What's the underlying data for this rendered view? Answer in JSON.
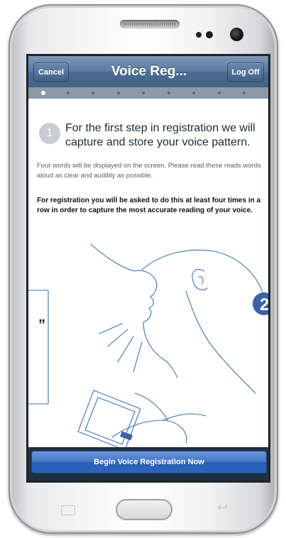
{
  "nav": {
    "cancel_label": "Cancel",
    "title": "Voice Reg...",
    "logoff_label": "Log Off"
  },
  "pager": {
    "total_pages": 9,
    "current_page": 1
  },
  "content": {
    "step_number": "1",
    "step_text": "For the first step in registration we will capture and store your voice pattern.",
    "description": "Four words will be displayed on the screen. Please read these reads words aloud as clear and audibly as possible.",
    "bold_note": "For registration you will be asked to do this at least four times in a row in order to capture the most accurate reading of your voice.",
    "illustration_badge": "2",
    "illustration_quote": "”"
  },
  "begin_button_label": "Begin Voice Registration Now",
  "icons": {
    "menu": "menu-icon",
    "home": "home-button",
    "back": "back-icon"
  },
  "colors": {
    "nav_bar": "#5a7aa0",
    "begin_button": "#3f72c6",
    "badge": "#3a62a8"
  }
}
